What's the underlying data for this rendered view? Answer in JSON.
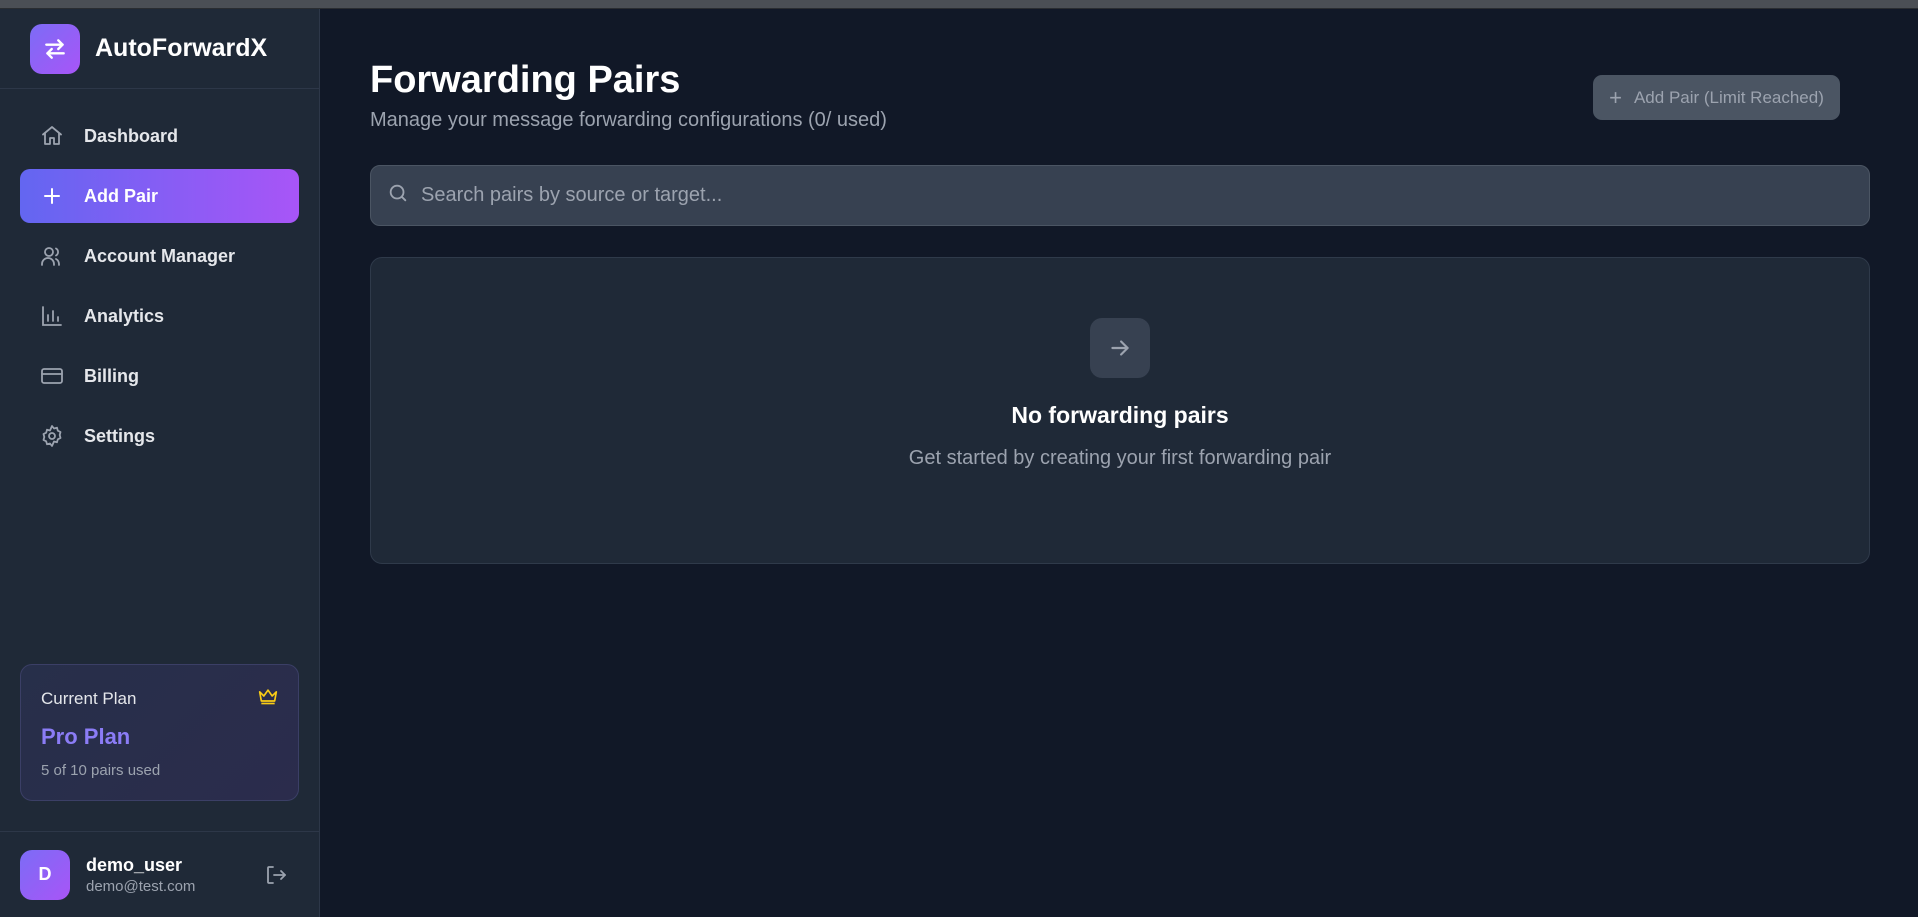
{
  "brand": {
    "name": "AutoForwardX",
    "logo_icon": "swap-arrows-icon"
  },
  "sidebar": {
    "items": [
      {
        "label": "Dashboard",
        "icon": "home-icon",
        "active": false
      },
      {
        "label": "Add Pair",
        "icon": "plus-icon",
        "active": true
      },
      {
        "label": "Account Manager",
        "icon": "users-icon",
        "active": false
      },
      {
        "label": "Analytics",
        "icon": "bar-chart-icon",
        "active": false
      },
      {
        "label": "Billing",
        "icon": "credit-card-icon",
        "active": false
      },
      {
        "label": "Settings",
        "icon": "gear-icon",
        "active": false
      }
    ],
    "plan": {
      "caption": "Current Plan",
      "name": "Pro Plan",
      "usage": "5 of 10 pairs used",
      "icon": "crown-icon"
    },
    "user": {
      "initial": "D",
      "name": "demo_user",
      "email": "demo@test.com"
    }
  },
  "main": {
    "title": "Forwarding Pairs",
    "subtitle": "Manage your message forwarding configurations (0/ used)",
    "add_button_label": "Add Pair (Limit Reached)",
    "search": {
      "placeholder": "Search pairs by source or target...",
      "value": ""
    },
    "empty_state": {
      "title": "No forwarding pairs",
      "text": "Get started by creating your first forwarding pair"
    }
  },
  "colors": {
    "background": "#111827",
    "sidebar": "#1f2937",
    "accent_start": "#6366f1",
    "accent_end": "#a855f7",
    "plan_name": "#8b7cf6",
    "crown": "#facc15"
  }
}
